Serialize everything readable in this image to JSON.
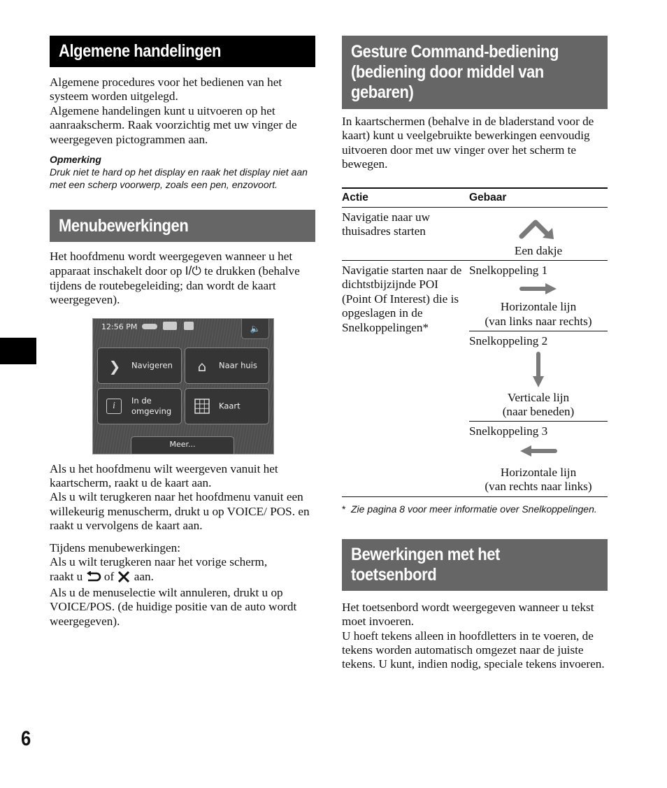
{
  "page_number": "6",
  "left": {
    "section1": {
      "title": "Algemene handelingen",
      "para1": "Algemene procedures voor het bedienen van het systeem worden uitgelegd.",
      "para2": "Algemene handelingen kunt u uitvoeren op het aanraakscherm. Raak voorzichtig met uw vinger de weergegeven pictogrammen aan.",
      "note_title": "Opmerking",
      "note_body": "Druk niet te hard op het display en raak het display niet aan met een scherp voorwerp, zoals een pen, enzovoort."
    },
    "section2": {
      "title": "Menubewerkingen",
      "para1_a": "Het hoofdmenu wordt weergegeven wanneer u het apparaat inschakelt door op ",
      "power_symbol": "I/⏻",
      "para1_b": " te drukken (behalve tijdens de routebegeleiding; dan wordt de kaart weergegeven).",
      "screen": {
        "time": "12:56 PM",
        "buttons": [
          {
            "label": "Navigeren",
            "icon": "chevron-right-icon"
          },
          {
            "label": "Naar huis",
            "icon": "house-icon"
          },
          {
            "label": "In de omgeving",
            "icon": "info-icon"
          },
          {
            "label": "Kaart",
            "icon": "grid-map-icon"
          }
        ],
        "more": "Meer..."
      },
      "para2": "Als u het hoofdmenu wilt weergeven vanuit het kaartscherm, raakt u de kaart aan.",
      "para3": "Als u wilt terugkeren naar het hoofdmenu vanuit een willekeurig menuscherm, drukt u op VOICE/ POS. en raakt u vervolgens de kaart aan.",
      "para4": "Tijdens menubewerkingen:",
      "para5": "Als u wilt terugkeren naar het vorige scherm,",
      "para6_a": "raakt u ",
      "para6_of": " of ",
      "para6_b": " aan.",
      "para7": "Als u de menuselectie wilt annuleren, drukt u op VOICE/POS. (de huidige positie van de auto wordt weergegeven)."
    }
  },
  "right": {
    "section3": {
      "title_lines": [
        "Gesture Command-bediening",
        "(bediening door middel van",
        "gebaren)"
      ],
      "intro": "In kaartschermen (behalve in de bladerstand voor de kaart) kunt u veelgebruikte bewerkingen eenvoudig uitvoeren door met uw vinger over het scherm te bewegen.",
      "table": {
        "headers": [
          "Actie",
          "Gebaar"
        ],
        "row1": {
          "action": "Navigatie naar uw thuisadres starten",
          "gesture_label": "Een dakje"
        },
        "row2": {
          "action": "Navigatie starten naar de dichtstbijzijnde POI (Point Of Interest) die is opgeslagen in de Snelkoppelingen*",
          "shortcuts": [
            {
              "name": "Snelkoppeling 1",
              "label1": "Horizontale lijn",
              "label2": "(van links naar rechts)"
            },
            {
              "name": "Snelkoppeling 2",
              "label1": "Verticale lijn",
              "label2": "(naar beneden)"
            },
            {
              "name": "Snelkoppeling 3",
              "label1": "Horizontale lijn",
              "label2": "(van rechts naar links)"
            }
          ]
        }
      },
      "footnote_mark": "*",
      "footnote": "Zie pagina 8 voor meer informatie over Snelkoppelingen."
    },
    "section4": {
      "title_lines": [
        "Bewerkingen met het",
        "toetsenbord"
      ],
      "para1": "Het toetsenbord wordt weergegeven wanneer u tekst moet invoeren.",
      "para2": "U hoeft tekens alleen in hoofdletters in te voeren, de tekens worden automatisch omgezet naar de juiste tekens. U kunt, indien nodig, speciale tekens invoeren."
    }
  },
  "colors": {
    "heading_black": "#000000",
    "heading_grey": "#666666",
    "arrow_grey": "#7a7a7a"
  }
}
